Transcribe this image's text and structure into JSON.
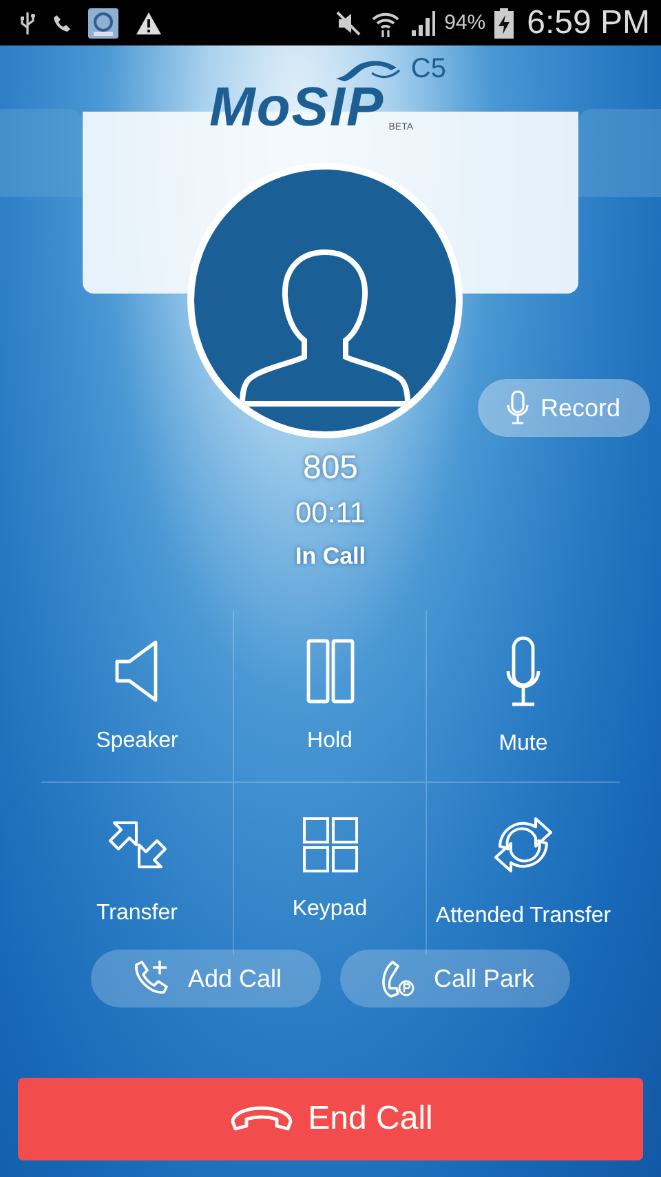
{
  "status_bar": {
    "battery": "94%",
    "time": "6:59 PM"
  },
  "logo": {
    "name": "MoSIP",
    "version": "C5",
    "tag": "BETA"
  },
  "record_button": {
    "label": "Record"
  },
  "call": {
    "number": "805",
    "duration": "00:11",
    "state": "In Call"
  },
  "actions": [
    {
      "kind": "speaker",
      "label": "Speaker"
    },
    {
      "kind": "hold",
      "label": "Hold"
    },
    {
      "kind": "mute",
      "label": "Mute"
    },
    {
      "kind": "transfer",
      "label": "Transfer"
    },
    {
      "kind": "keypad",
      "label": "Keypad"
    },
    {
      "kind": "attended",
      "label": "Attended Transfer"
    }
  ],
  "pills": [
    {
      "kind": "add",
      "label": "Add Call"
    },
    {
      "kind": "park",
      "label": "Call Park"
    }
  ],
  "end_button": {
    "label": "End Call"
  }
}
